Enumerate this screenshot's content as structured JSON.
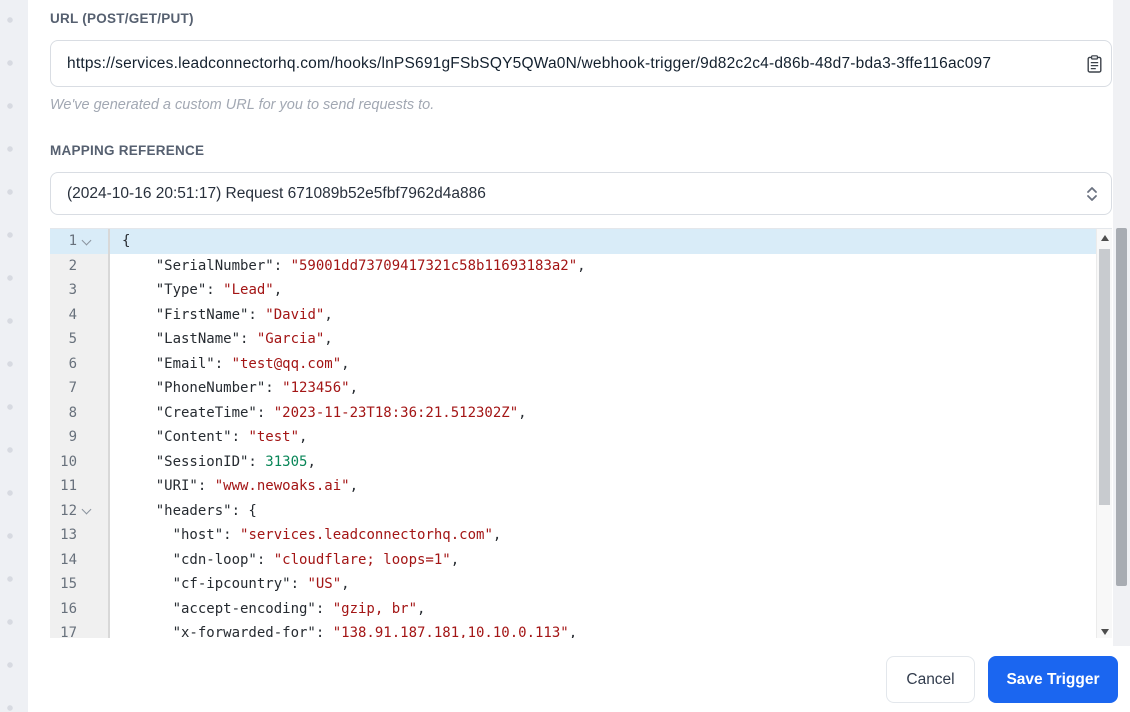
{
  "url_section": {
    "label": "URL (POST/GET/PUT)",
    "value": "https://services.leadconnectorhq.com/hooks/lnPS691gFSbSQY5QWa0N/webhook-trigger/9d82c2c4-d86b-48d7-bda3-3ffe116ac097",
    "copy_icon": "clipboard-icon",
    "helper": "We've generated a custom URL for you to send requests to."
  },
  "mapping_section": {
    "label": "MAPPING REFERENCE",
    "selected_option": "(2024-10-16 20:51:17) Request 671089b52e5fbf7962d4a886",
    "select_icon": "updown-chevron-icon"
  },
  "editor": {
    "language": "json",
    "active_line": 1,
    "lines": [
      {
        "num": 1,
        "fold": true,
        "active": true,
        "segments": [
          [
            "p",
            "{"
          ]
        ]
      },
      {
        "num": 2,
        "segments": [
          [
            "p",
            "    \"SerialNumber\": "
          ],
          [
            "s",
            "\"59001dd73709417321c58b11693183a2\""
          ],
          [
            "p",
            ","
          ]
        ]
      },
      {
        "num": 3,
        "segments": [
          [
            "p",
            "    \"Type\": "
          ],
          [
            "s",
            "\"Lead\""
          ],
          [
            "p",
            ","
          ]
        ]
      },
      {
        "num": 4,
        "segments": [
          [
            "p",
            "    \"FirstName\": "
          ],
          [
            "s",
            "\"David\""
          ],
          [
            "p",
            ","
          ]
        ]
      },
      {
        "num": 5,
        "segments": [
          [
            "p",
            "    \"LastName\": "
          ],
          [
            "s",
            "\"Garcia\""
          ],
          [
            "p",
            ","
          ]
        ]
      },
      {
        "num": 6,
        "segments": [
          [
            "p",
            "    \"Email\": "
          ],
          [
            "s",
            "\"test@qq.com\""
          ],
          [
            "p",
            ","
          ]
        ]
      },
      {
        "num": 7,
        "segments": [
          [
            "p",
            "    \"PhoneNumber\": "
          ],
          [
            "s",
            "\"123456\""
          ],
          [
            "p",
            ","
          ]
        ]
      },
      {
        "num": 8,
        "segments": [
          [
            "p",
            "    \"CreateTime\": "
          ],
          [
            "s",
            "\"2023-11-23T18:36:21.512302Z\""
          ],
          [
            "p",
            ","
          ]
        ]
      },
      {
        "num": 9,
        "segments": [
          [
            "p",
            "    \"Content\": "
          ],
          [
            "s",
            "\"test\""
          ],
          [
            "p",
            ","
          ]
        ]
      },
      {
        "num": 10,
        "segments": [
          [
            "p",
            "    \"SessionID\": "
          ],
          [
            "n",
            "31305"
          ],
          [
            "p",
            ","
          ]
        ]
      },
      {
        "num": 11,
        "segments": [
          [
            "p",
            "    \"URI\": "
          ],
          [
            "s",
            "\"www.newoaks.ai\""
          ],
          [
            "p",
            ","
          ]
        ]
      },
      {
        "num": 12,
        "fold": true,
        "segments": [
          [
            "p",
            "    \"headers\": {"
          ]
        ]
      },
      {
        "num": 13,
        "segments": [
          [
            "p",
            "      \"host\": "
          ],
          [
            "s",
            "\"services.leadconnectorhq.com\""
          ],
          [
            "p",
            ","
          ]
        ]
      },
      {
        "num": 14,
        "segments": [
          [
            "p",
            "      \"cdn-loop\": "
          ],
          [
            "s",
            "\"cloudflare; loops=1\""
          ],
          [
            "p",
            ","
          ]
        ]
      },
      {
        "num": 15,
        "segments": [
          [
            "p",
            "      \"cf-ipcountry\": "
          ],
          [
            "s",
            "\"US\""
          ],
          [
            "p",
            ","
          ]
        ]
      },
      {
        "num": 16,
        "segments": [
          [
            "p",
            "      \"accept-encoding\": "
          ],
          [
            "s",
            "\"gzip, br\""
          ],
          [
            "p",
            ","
          ]
        ]
      },
      {
        "num": 17,
        "segments": [
          [
            "p",
            "      \"x-forwarded-for\": "
          ],
          [
            "s",
            "\"138.91.187.181,10.10.0.113\""
          ],
          [
            "p",
            ","
          ]
        ]
      }
    ]
  },
  "footer": {
    "cancel_label": "Cancel",
    "save_label": "Save Trigger"
  },
  "colors": {
    "accent_blue": "#1b66f0",
    "active_line_bg": "#d9ecf8",
    "syntax_string": "#a31515",
    "syntax_number": "#098658"
  }
}
